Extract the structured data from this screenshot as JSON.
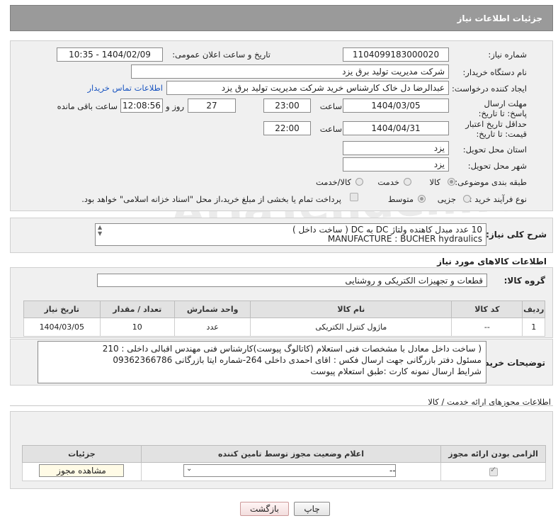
{
  "header": {
    "title": "جزئیات اطلاعات نیاز"
  },
  "form": {
    "need_number_label": "شماره نیاز:",
    "need_number": "1104099183000020",
    "announce_label": "تاریخ و ساعت اعلان عمومی:",
    "announce_value": "1404/02/09 - 10:35",
    "buyer_org_label": "نام دستگاه خریدار:",
    "buyer_org": "شرکت مدیریت تولید برق یزد",
    "creator_label": "ایجاد کننده درخواست:",
    "creator": "عبدالرضا دل خاک کارشناس خرید شرکت مدیریت تولید برق یزد",
    "contact_link": "اطلاعات تماس خریدار",
    "deadline_label": "مهلت ارسال پاسخ: تا تاریخ:",
    "deadline_date": "1404/03/05",
    "time_label": "ساعت",
    "deadline_time": "23:00",
    "days": "27",
    "day_and": "روز و",
    "remaining_time": "12:08:56",
    "remaining_label": "ساعت باقی مانده",
    "min_price_label": "حداقل تاریخ اعتبار قیمت: تا تاریخ:",
    "price_date": "1404/04/31",
    "price_time": "22:00",
    "province_label": "استان محل تحویل:",
    "province": "یزد",
    "city_label": "شهر محل تحویل:",
    "city": "یزد",
    "category_label": "طبقه بندی موضوعی:",
    "cat_goods": "کالا",
    "cat_service": "خدمت",
    "cat_both": "کالا/خدمت",
    "process_label": "نوع فرآیند خرید :",
    "proc_minor": "جزیی",
    "proc_medium": "متوسط",
    "payment_note": "پرداخت تمام یا بخشی از مبلغ خرید،از محل \"اسناد خزانه اسلامی\" خواهد بود."
  },
  "general": {
    "label": "شرح کلی نیاز:",
    "line1": "10 عدد مبدل کاهنده ولتاژ DC  به  DC  ( ساخت داخل )",
    "line2": "MANUFACTURE : BUCHER hydraulics"
  },
  "goods": {
    "section_title": "اطلاعات کالاهای مورد نیاز",
    "group_label": "گروه کالا:",
    "group_value": "قطعات و تجهیزات الکتریکی و روشنایی",
    "columns": [
      "ردیف",
      "کد کالا",
      "نام کالا",
      "واحد شمارش",
      "تعداد / مقدار",
      "تاریخ نیاز"
    ],
    "rows": [
      {
        "row": "1",
        "code": "--",
        "name": "ماژول کنترل الکتریکی",
        "unit": "عدد",
        "qty": "10",
        "date": "1404/03/05"
      }
    ]
  },
  "notes": {
    "label": "توضیحات خریدار:",
    "line1": "( ساخت داخل معادل با مشخصات فنی استعلام (کاتالوگ پیوست)کارشناس فنی مهندس اقبالی داخلی : 210",
    "line2": "مسئول دفتر بازرگانی جهت ارسال فکس : اقای احمدی داخلی 264-شماره ایتا بازرگانی 09362366786",
    "line3": "شرایط ارسال نمونه کارت :طبق استعلام پیوست"
  },
  "permits": {
    "section_title": "اطلاعات مجوزهای ارائه خدمت / کالا",
    "columns": [
      "الزامی بودن ارائه مجوز",
      "اعلام وضعیت مجوز توسط تامین کننده",
      "جزئیات"
    ],
    "select_value": "--",
    "view_button": "مشاهده مجوز"
  },
  "actions": {
    "print": "چاپ",
    "back": "بازگشت"
  },
  "watermark": "AriaTender.neT"
}
